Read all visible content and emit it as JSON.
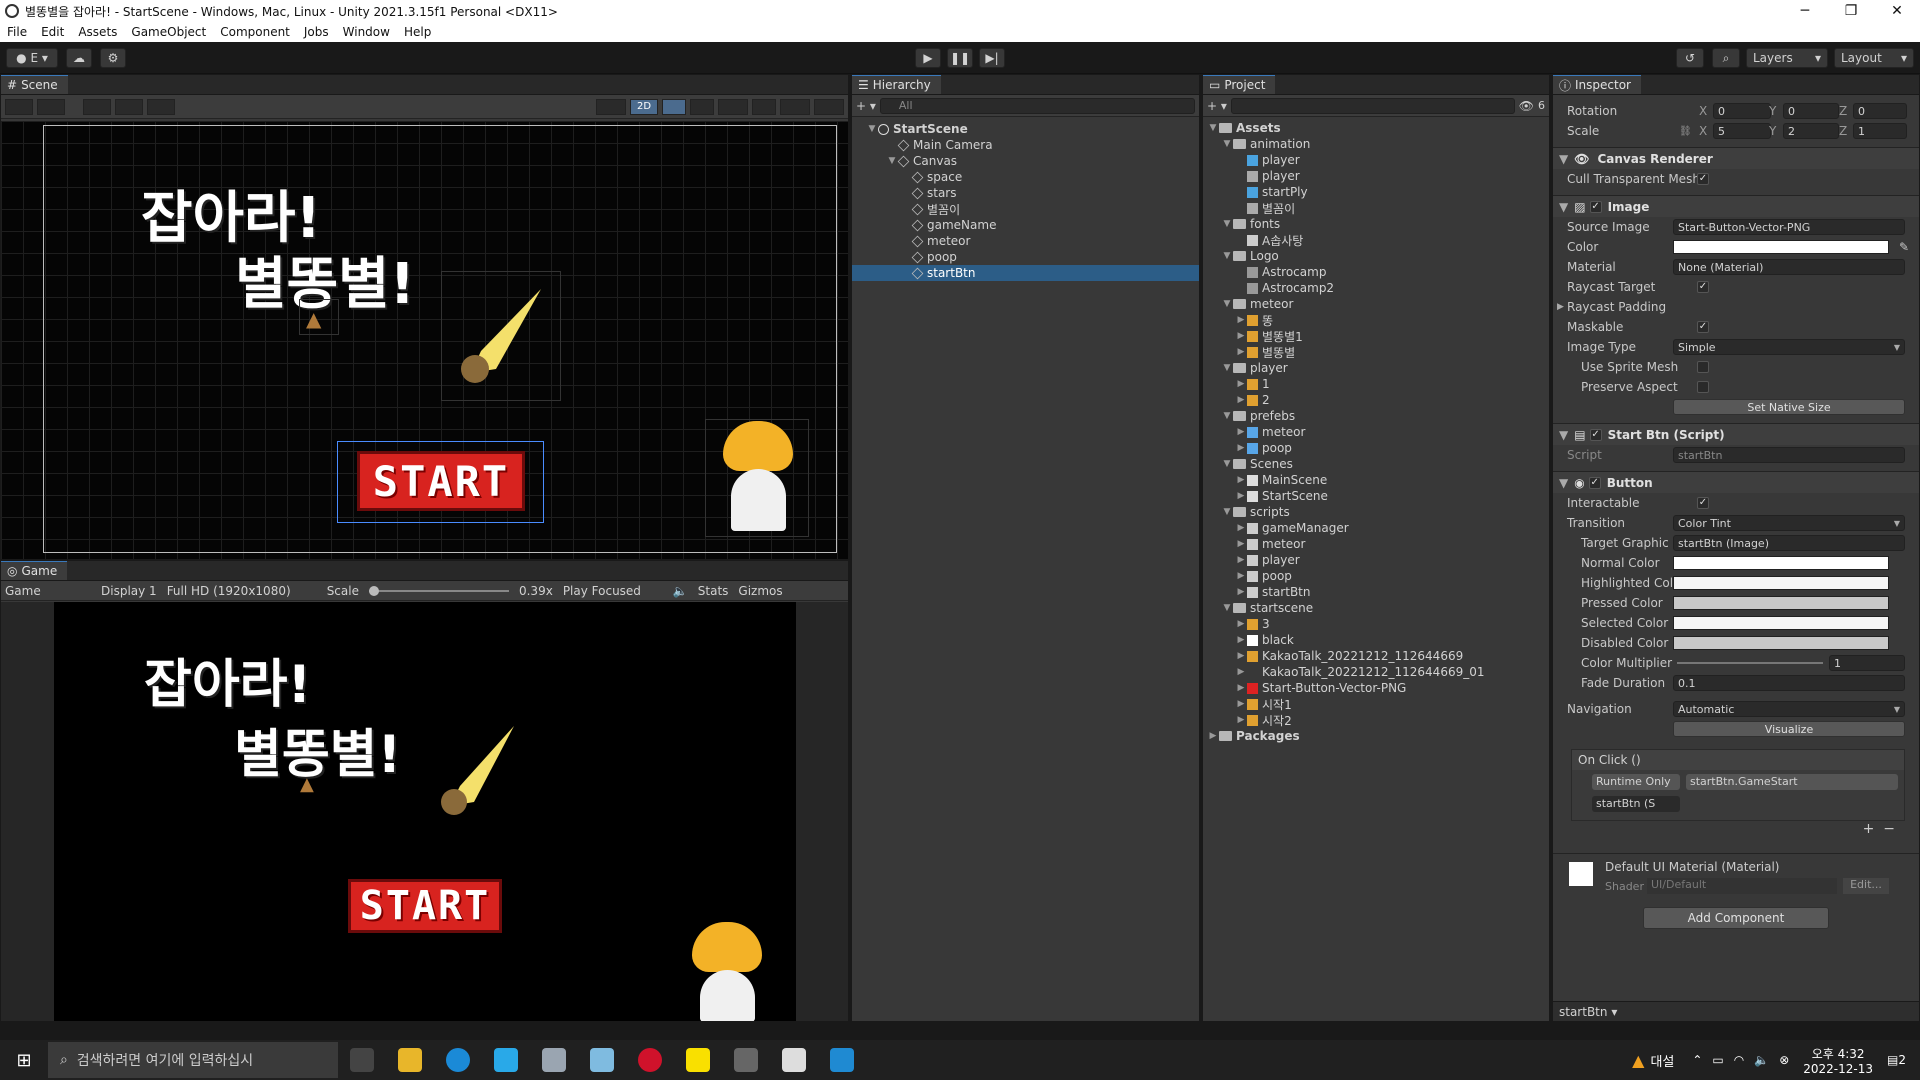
{
  "window": {
    "title": "별똥별을 잡아라! - StartScene - Windows, Mac, Linux - Unity 2021.3.15f1 Personal <DX11>"
  },
  "menu": [
    "File",
    "Edit",
    "Assets",
    "GameObject",
    "Component",
    "Jobs",
    "Window",
    "Help"
  ],
  "toolbar": {
    "account": "E",
    "layers": "Layers",
    "layout": "Layout"
  },
  "scene": {
    "tab": "Scene",
    "mode2d": "2D"
  },
  "game_text": {
    "line1": "잡아라!",
    "line2": "별똥별!",
    "start": "START"
  },
  "game": {
    "tab": "Game",
    "view": "Game",
    "display": "Display 1",
    "resolution": "Full HD (1920x1080)",
    "scale_label": "Scale",
    "scale_value": "0.39x",
    "play_mode": "Play Focused",
    "stats": "Stats",
    "gizmos": "Gizmos"
  },
  "hierarchy": {
    "tab": "Hierarchy",
    "search": "All",
    "scene": "StartScene",
    "items": [
      "Main Camera",
      "Canvas",
      "space",
      "stars",
      "별꼼이",
      "gameName",
      "meteor",
      "poop",
      "startBtn"
    ]
  },
  "project": {
    "tab": "Project",
    "badge": "6",
    "rows": [
      {
        "t": "Assets",
        "lvl": 0,
        "kind": "folder",
        "open": true,
        "bold": true
      },
      {
        "t": "animation",
        "lvl": 1,
        "kind": "folder",
        "open": true
      },
      {
        "t": "player",
        "lvl": 2,
        "kind": "anim"
      },
      {
        "t": "player",
        "lvl": 2,
        "kind": "ctrl"
      },
      {
        "t": "startPly",
        "lvl": 2,
        "kind": "anim"
      },
      {
        "t": "별꼼이",
        "lvl": 2,
        "kind": "ctrl"
      },
      {
        "t": "fonts",
        "lvl": 1,
        "kind": "folder",
        "open": true
      },
      {
        "t": "A솝사탕",
        "lvl": 2,
        "kind": "font"
      },
      {
        "t": "Logo",
        "lvl": 1,
        "kind": "folder",
        "open": true
      },
      {
        "t": "Astrocamp",
        "lvl": 2,
        "kind": "img"
      },
      {
        "t": "Astrocamp2",
        "lvl": 2,
        "kind": "img"
      },
      {
        "t": "meteor",
        "lvl": 1,
        "kind": "folder",
        "open": true
      },
      {
        "t": "똥",
        "lvl": 2,
        "kind": "sprite"
      },
      {
        "t": "별똥별1",
        "lvl": 2,
        "kind": "sprite"
      },
      {
        "t": "별똥별",
        "lvl": 2,
        "kind": "sprite"
      },
      {
        "t": "player",
        "lvl": 1,
        "kind": "folder",
        "open": true
      },
      {
        "t": "1",
        "lvl": 2,
        "kind": "sprite"
      },
      {
        "t": "2",
        "lvl": 2,
        "kind": "sprite"
      },
      {
        "t": "prefebs",
        "lvl": 1,
        "kind": "folder",
        "open": true
      },
      {
        "t": "meteor",
        "lvl": 2,
        "kind": "prefab"
      },
      {
        "t": "poop",
        "lvl": 2,
        "kind": "prefab"
      },
      {
        "t": "Scenes",
        "lvl": 1,
        "kind": "folder",
        "open": true
      },
      {
        "t": "MainScene",
        "lvl": 2,
        "kind": "scene"
      },
      {
        "t": "StartScene",
        "lvl": 2,
        "kind": "scene"
      },
      {
        "t": "scripts",
        "lvl": 1,
        "kind": "folder",
        "open": true
      },
      {
        "t": "gameManager",
        "lvl": 2,
        "kind": "gear"
      },
      {
        "t": "meteor",
        "lvl": 2,
        "kind": "script"
      },
      {
        "t": "player",
        "lvl": 2,
        "kind": "script"
      },
      {
        "t": "poop",
        "lvl": 2,
        "kind": "script"
      },
      {
        "t": "startBtn",
        "lvl": 2,
        "kind": "script"
      },
      {
        "t": "startscene",
        "lvl": 1,
        "kind": "folder",
        "open": true
      },
      {
        "t": "3",
        "lvl": 2,
        "kind": "sprite"
      },
      {
        "t": "black",
        "lvl": 2,
        "kind": "white"
      },
      {
        "t": "KakaoTalk_20221212_112644669",
        "lvl": 2,
        "kind": "sprite"
      },
      {
        "t": "KakaoTalk_20221212_112644669_01",
        "lvl": 2,
        "kind": "blank"
      },
      {
        "t": "Start-Button-Vector-PNG",
        "lvl": 2,
        "kind": "red"
      },
      {
        "t": "시작1",
        "lvl": 2,
        "kind": "sprite"
      },
      {
        "t": "시작2",
        "lvl": 2,
        "kind": "sprite"
      },
      {
        "t": "Packages",
        "lvl": 0,
        "kind": "folder",
        "open": false,
        "bold": true
      }
    ]
  },
  "inspector": {
    "tab": "Inspector",
    "rotation": {
      "label": "Rotation",
      "x": "0",
      "y": "0",
      "z": "0"
    },
    "scale": {
      "label": "Scale",
      "x": "5",
      "y": "2",
      "z": "1"
    },
    "canvas_renderer": {
      "title": "Canvas Renderer",
      "cull_label": "Cull Transparent Mesh"
    },
    "image": {
      "title": "Image",
      "source_label": "Source Image",
      "source": "Start-Button-Vector-PNG",
      "color_label": "Color",
      "material_label": "Material",
      "material": "None (Material)",
      "raycast_target": "Raycast Target",
      "raycast_padding": "Raycast Padding",
      "maskable": "Maskable",
      "image_type_label": "Image Type",
      "image_type": "Simple",
      "use_sprite_mesh": "Use Sprite Mesh",
      "preserve_aspect": "Preserve Aspect",
      "native_size": "Set Native Size"
    },
    "script": {
      "title": "Start Btn (Script)",
      "label": "Script",
      "value": "startBtn"
    },
    "button": {
      "title": "Button",
      "interactable": "Interactable",
      "transition_label": "Transition",
      "transition": "Color Tint",
      "target_label": "Target Graphic",
      "target": "startBtn (Image)",
      "normal": "Normal Color",
      "highlighted": "Highlighted Color",
      "pressed": "Pressed Color",
      "selected": "Selected Color",
      "disabled": "Disabled Color",
      "multiplier_label": "Color Multiplier",
      "multiplier": "1",
      "fade_label": "Fade Duration",
      "fade": "0.1",
      "navigation_label": "Navigation",
      "navigation": "Automatic",
      "visualize": "Visualize",
      "onclick": "On Click ()",
      "runtime": "Runtime Only",
      "function": "startBtn.GameStart",
      "object": "startBtn (S"
    },
    "material": {
      "title": "Default UI Material (Material)",
      "shader_label": "Shader",
      "shader": "UI/Default",
      "edit": "Edit..."
    },
    "add_component": "Add Component",
    "footer": "startBtn"
  },
  "taskbar": {
    "search": "검색하려면 여기에 입력하십시",
    "weather": "대설",
    "time": "오후 4:32",
    "date": "2022-12-13",
    "notif": "2"
  },
  "colors": {
    "selection": "#2c5d87",
    "tab_accent": "#3a79bb",
    "panel": "#383838"
  }
}
